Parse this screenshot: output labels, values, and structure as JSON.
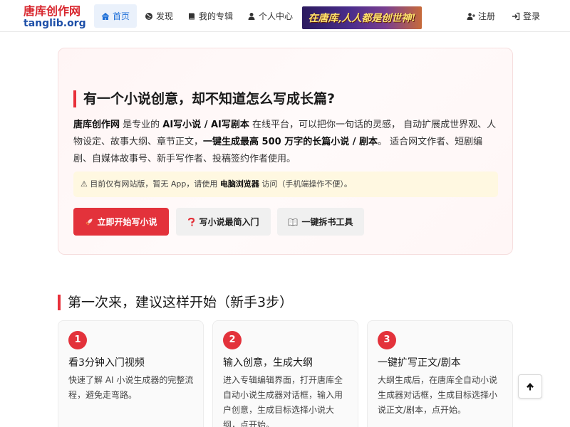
{
  "brand": {
    "name_cn": "唐库创作网",
    "name_en": "tanglib.org",
    "color_cn": "#d8282f",
    "color_en": "#1d4fa8"
  },
  "nav": {
    "home": "首页",
    "discover": "发现",
    "my_works": "我的专辑",
    "profile": "个人中心",
    "banner_text": "在唐库,人人都是创世神!",
    "register": "注册",
    "login": "登录"
  },
  "hero": {
    "title": "有一个小说创意，却不知道怎么写成长篇?",
    "desc_1": "唐库创作网",
    "desc_2": " 是专业的 ",
    "desc_3": "AI写小说 / AI写剧本",
    "desc_4": " 在线平台，可以把你一句话的灵感， 自动扩展成世界观、人物设定、故事大纲、章节正文，",
    "desc_5": "一键生成最高 500 万字的长篇小说 / 剧本",
    "desc_6": "。 适合网文作者、短剧编剧、自媒体故事号、新手写作者、投稿签约作者使用。",
    "notice_1": "⚠ 目前仅有网站版，暂无 App，请使用 ",
    "notice_2": "电脑浏览器",
    "notice_3": " 访问（手机端操作不便）。",
    "btn_start": "立即开始写小说",
    "btn_guide": "写小说最简入门",
    "btn_tool": "一键拆书工具",
    "accent": "#e3323b"
  },
  "section": {
    "title": "第一次来，建议这样开始（新手3步）"
  },
  "steps": [
    {
      "num": "1",
      "title": "看3分钟入门视频",
      "desc": "快速了解 AI 小说生成器的完整流程，避免走弯路。"
    },
    {
      "num": "2",
      "title": "输入创意，生成大纲",
      "desc": "进入专辑编辑界面，打开唐库全自动小说生成器对话框，输入用户创意，生成目标选择小说大纲，点开始。"
    },
    {
      "num": "3",
      "title": "一键扩写正文/剧本",
      "desc": "大纲生成后，在唐库全自动小说生成器对话框，生成目标选择小说正文/剧本，点开始。"
    }
  ]
}
